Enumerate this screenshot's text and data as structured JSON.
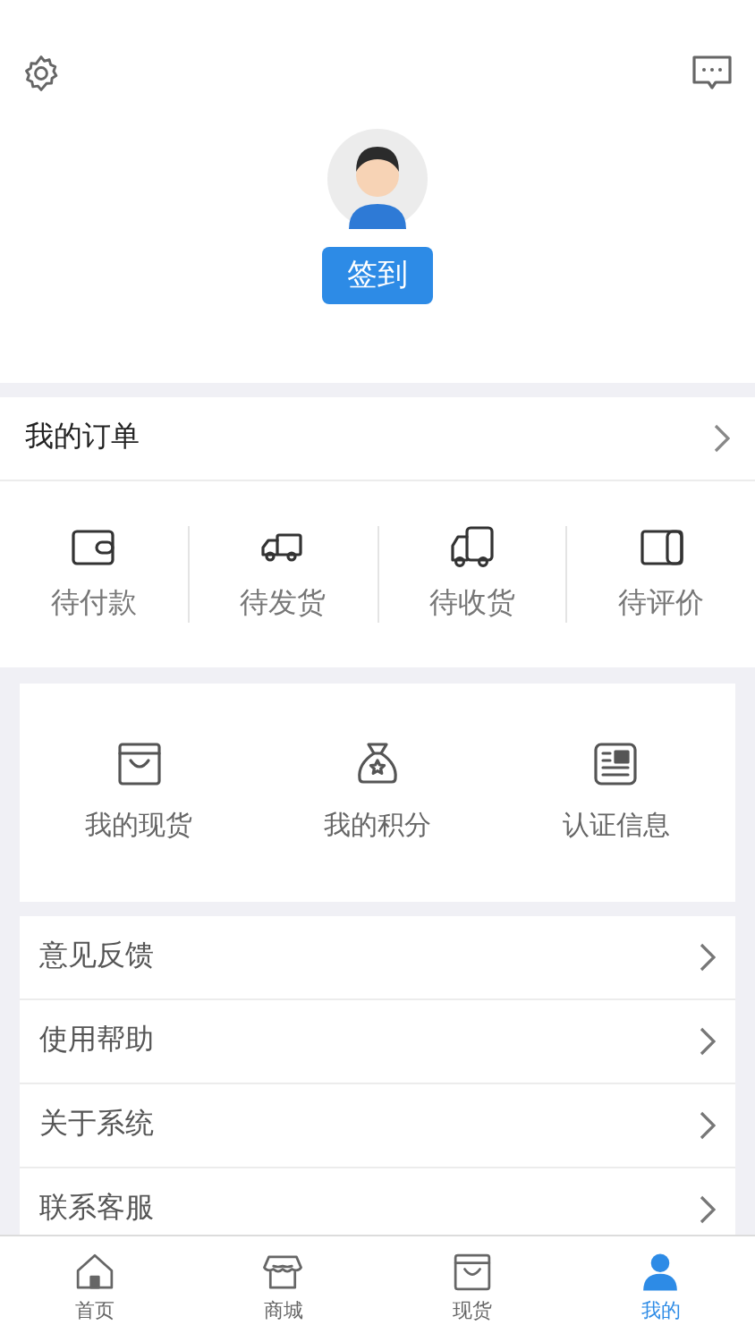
{
  "header": {
    "checkin_button": "签到"
  },
  "orders": {
    "title": "我的订单",
    "statuses": [
      {
        "label": "待付款",
        "kind": "wallet"
      },
      {
        "label": "待发货",
        "kind": "truck"
      },
      {
        "label": "待收货",
        "kind": "van"
      },
      {
        "label": "待评价",
        "kind": "scroll"
      }
    ]
  },
  "shortcuts": [
    {
      "label": "我的现货",
      "kind": "bag"
    },
    {
      "label": "我的积分",
      "kind": "sack"
    },
    {
      "label": "认证信息",
      "kind": "card"
    }
  ],
  "menu": [
    "意见反馈",
    "使用帮助",
    "关于系统",
    "联系客服"
  ],
  "tabs": [
    {
      "label": "首页",
      "kind": "home",
      "selected": false
    },
    {
      "label": "商城",
      "kind": "shop",
      "selected": false
    },
    {
      "label": "现货",
      "kind": "bag",
      "selected": false
    },
    {
      "label": "我的",
      "kind": "user",
      "selected": true
    }
  ]
}
